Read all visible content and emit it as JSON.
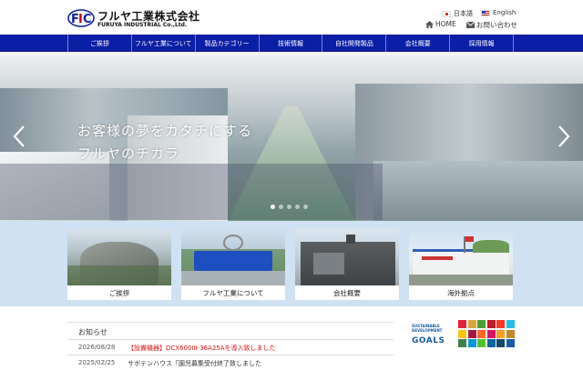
{
  "header": {
    "company_name_jp": "フルヤ工業株式会社",
    "company_name_en": "FURUYA INDUSTRIAL Co.,Ltd.",
    "lang_ja": "日本語",
    "lang_en": "English",
    "home_label": "HOME",
    "contact_label": "お問い合わせ"
  },
  "nav": {
    "items": [
      {
        "label": "ご挨拶"
      },
      {
        "label": "フルヤ工業について"
      },
      {
        "label": "製品カテゴリー"
      },
      {
        "label": "技術情報"
      },
      {
        "label": "自社開発製品"
      },
      {
        "label": "会社概要"
      },
      {
        "label": "採用情報"
      }
    ]
  },
  "hero": {
    "catch_line1": "お客様の夢をカタチにする",
    "catch_line2": "フルヤのチカラ",
    "slide_count": 5,
    "active_slide": 1
  },
  "cards": [
    {
      "label": "ご挨拶",
      "icon": "greeting-photo"
    },
    {
      "label": "フルヤ工業について",
      "icon": "about-photo"
    },
    {
      "label": "会社概要",
      "icon": "company-photo"
    },
    {
      "label": "海外拠点",
      "icon": "overseas-photo"
    }
  ],
  "news": {
    "title": "お知らせ",
    "items": [
      {
        "date": "2026/08/28",
        "text": "【設備機器】DCX600III-36A25Aを導入致しました"
      },
      {
        "date": "2025/02/25",
        "text": "サボテンハウス「園児募集受付終了致しました"
      }
    ]
  },
  "sdgs": {
    "line1": "SUSTAINABLE",
    "line2": "DEVELOPMENT",
    "line3": "GOALS",
    "colors": [
      "#e5243b",
      "#dda63a",
      "#4c9f38",
      "#c5192d",
      "#ff3a21",
      "#26bde2",
      "#fcc30b",
      "#a21942",
      "#fd6925",
      "#dd1367",
      "#fd9d24",
      "#bf8b2e",
      "#3f7e44",
      "#0a97d9",
      "#56c02b",
      "#00689d",
      "#19486a",
      "#1a5aa6"
    ]
  },
  "colors": {
    "nav_bg": "#0b1ea6",
    "cards_band": "#cfe2f3",
    "news_highlight": "#d11111"
  }
}
